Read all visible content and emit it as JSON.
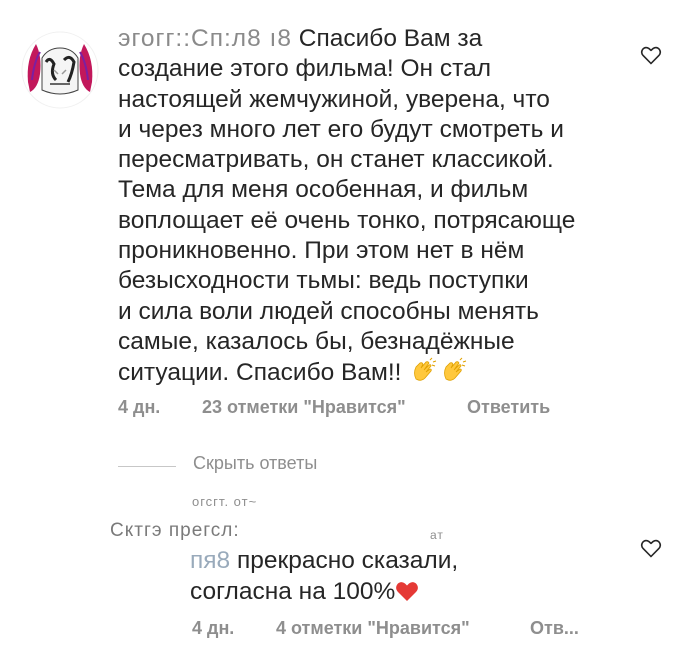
{
  "comment": {
    "username_fragment": "эгогг::Сп:л8 ı8",
    "text": "Спасибо Вам за\nсоздание этого фильма! Он стал\nнастоящей жемчужиной, уверена, что\nи через много лет его будут смотреть и\nпересматривать, он станет классикой.\nТема для меня особенная, и фильм\nвоплощает её очень тонко, потрясающе\nпроникновенно. При этом нет в нём\nбезысходности тьмы: ведь поступки\nи сила воли людей способны менять\nсамые, казалось бы, безнадёжные\nситуации. Спасибо Вам!! ",
    "emojis": [
      "clapping-hands",
      "clapping-hands"
    ],
    "time": "4 дн.",
    "likes": "23 отметки \"Нравится\"",
    "reply_label": "Ответить"
  },
  "hide_replies_label": "Скрыть ответы",
  "reply": {
    "blurred_top": "огсгт. от~",
    "blurred_mid": "Сктгэ прегсл:",
    "blurred_right": "ат",
    "username_fragment": "пя8",
    "text_first": "прекрасно  сказали,",
    "text_second": "согласна на 100%",
    "emoji": "red-heart",
    "time": "4 дн.",
    "likes": "4 отметки \"Нравится\"",
    "reply_label": "Отв..."
  },
  "colors": {
    "text": "#262626",
    "secondary": "#8e8e8e",
    "heart_red": "#e53935",
    "clap_yellow": "#ffc83d"
  }
}
